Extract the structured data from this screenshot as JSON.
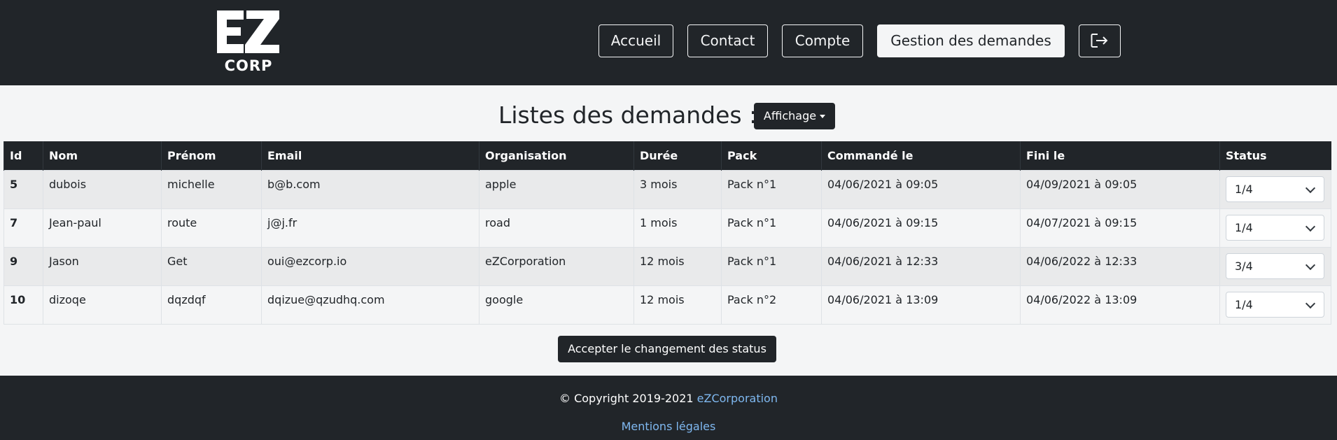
{
  "header": {
    "logo_text_top": "EZ",
    "logo_text_bottom": "CORP",
    "nav": [
      {
        "label": "Accueil"
      },
      {
        "label": "Contact"
      },
      {
        "label": "Compte"
      },
      {
        "label": "Gestion des demandes"
      }
    ],
    "logout_icon": "logout-icon"
  },
  "main": {
    "title": "Listes des demandes :",
    "affichage_label": "Affichage",
    "columns": [
      "Id",
      "Nom",
      "Prénom",
      "Email",
      "Organisation",
      "Durée",
      "Pack",
      "Commandé le",
      "Fini le",
      "Status"
    ],
    "rows": [
      {
        "id": "5",
        "nom": "dubois",
        "prenom": "michelle",
        "email": "b@b.com",
        "organisation": "apple",
        "duree": "3 mois",
        "pack": "Pack n°1",
        "commande": "04/06/2021 à 09:05",
        "fini": "04/09/2021 à 09:05",
        "status": "1/4"
      },
      {
        "id": "7",
        "nom": "Jean-paul",
        "prenom": "route",
        "email": "j@j.fr",
        "organisation": "road",
        "duree": "1 mois",
        "pack": "Pack n°1",
        "commande": "04/06/2021 à 09:15",
        "fini": "04/07/2021 à 09:15",
        "status": "1/4"
      },
      {
        "id": "9",
        "nom": "Jason",
        "prenom": "Get",
        "email": "oui@ezcorp.io",
        "organisation": "eZCorporation",
        "duree": "12 mois",
        "pack": "Pack n°1",
        "commande": "04/06/2021 à 12:33",
        "fini": "04/06/2022 à 12:33",
        "status": "3/4"
      },
      {
        "id": "10",
        "nom": "dizoqe",
        "prenom": "dqzdqf",
        "email": "dqizue@qzudhq.com",
        "organisation": "google",
        "duree": "12 mois",
        "pack": "Pack n°2",
        "commande": "04/06/2021 à 13:09",
        "fini": "04/06/2022 à 13:09",
        "status": "1/4"
      }
    ],
    "accept_label": "Accepter le changement des status"
  },
  "footer": {
    "copyright": "© Copyright 2019-2021 ",
    "company_link": "eZCorporation",
    "mentions": "Mentions légales"
  },
  "colors": {
    "dark": "#212529",
    "light": "#f4f5f6",
    "link": "#7fb8f0"
  }
}
